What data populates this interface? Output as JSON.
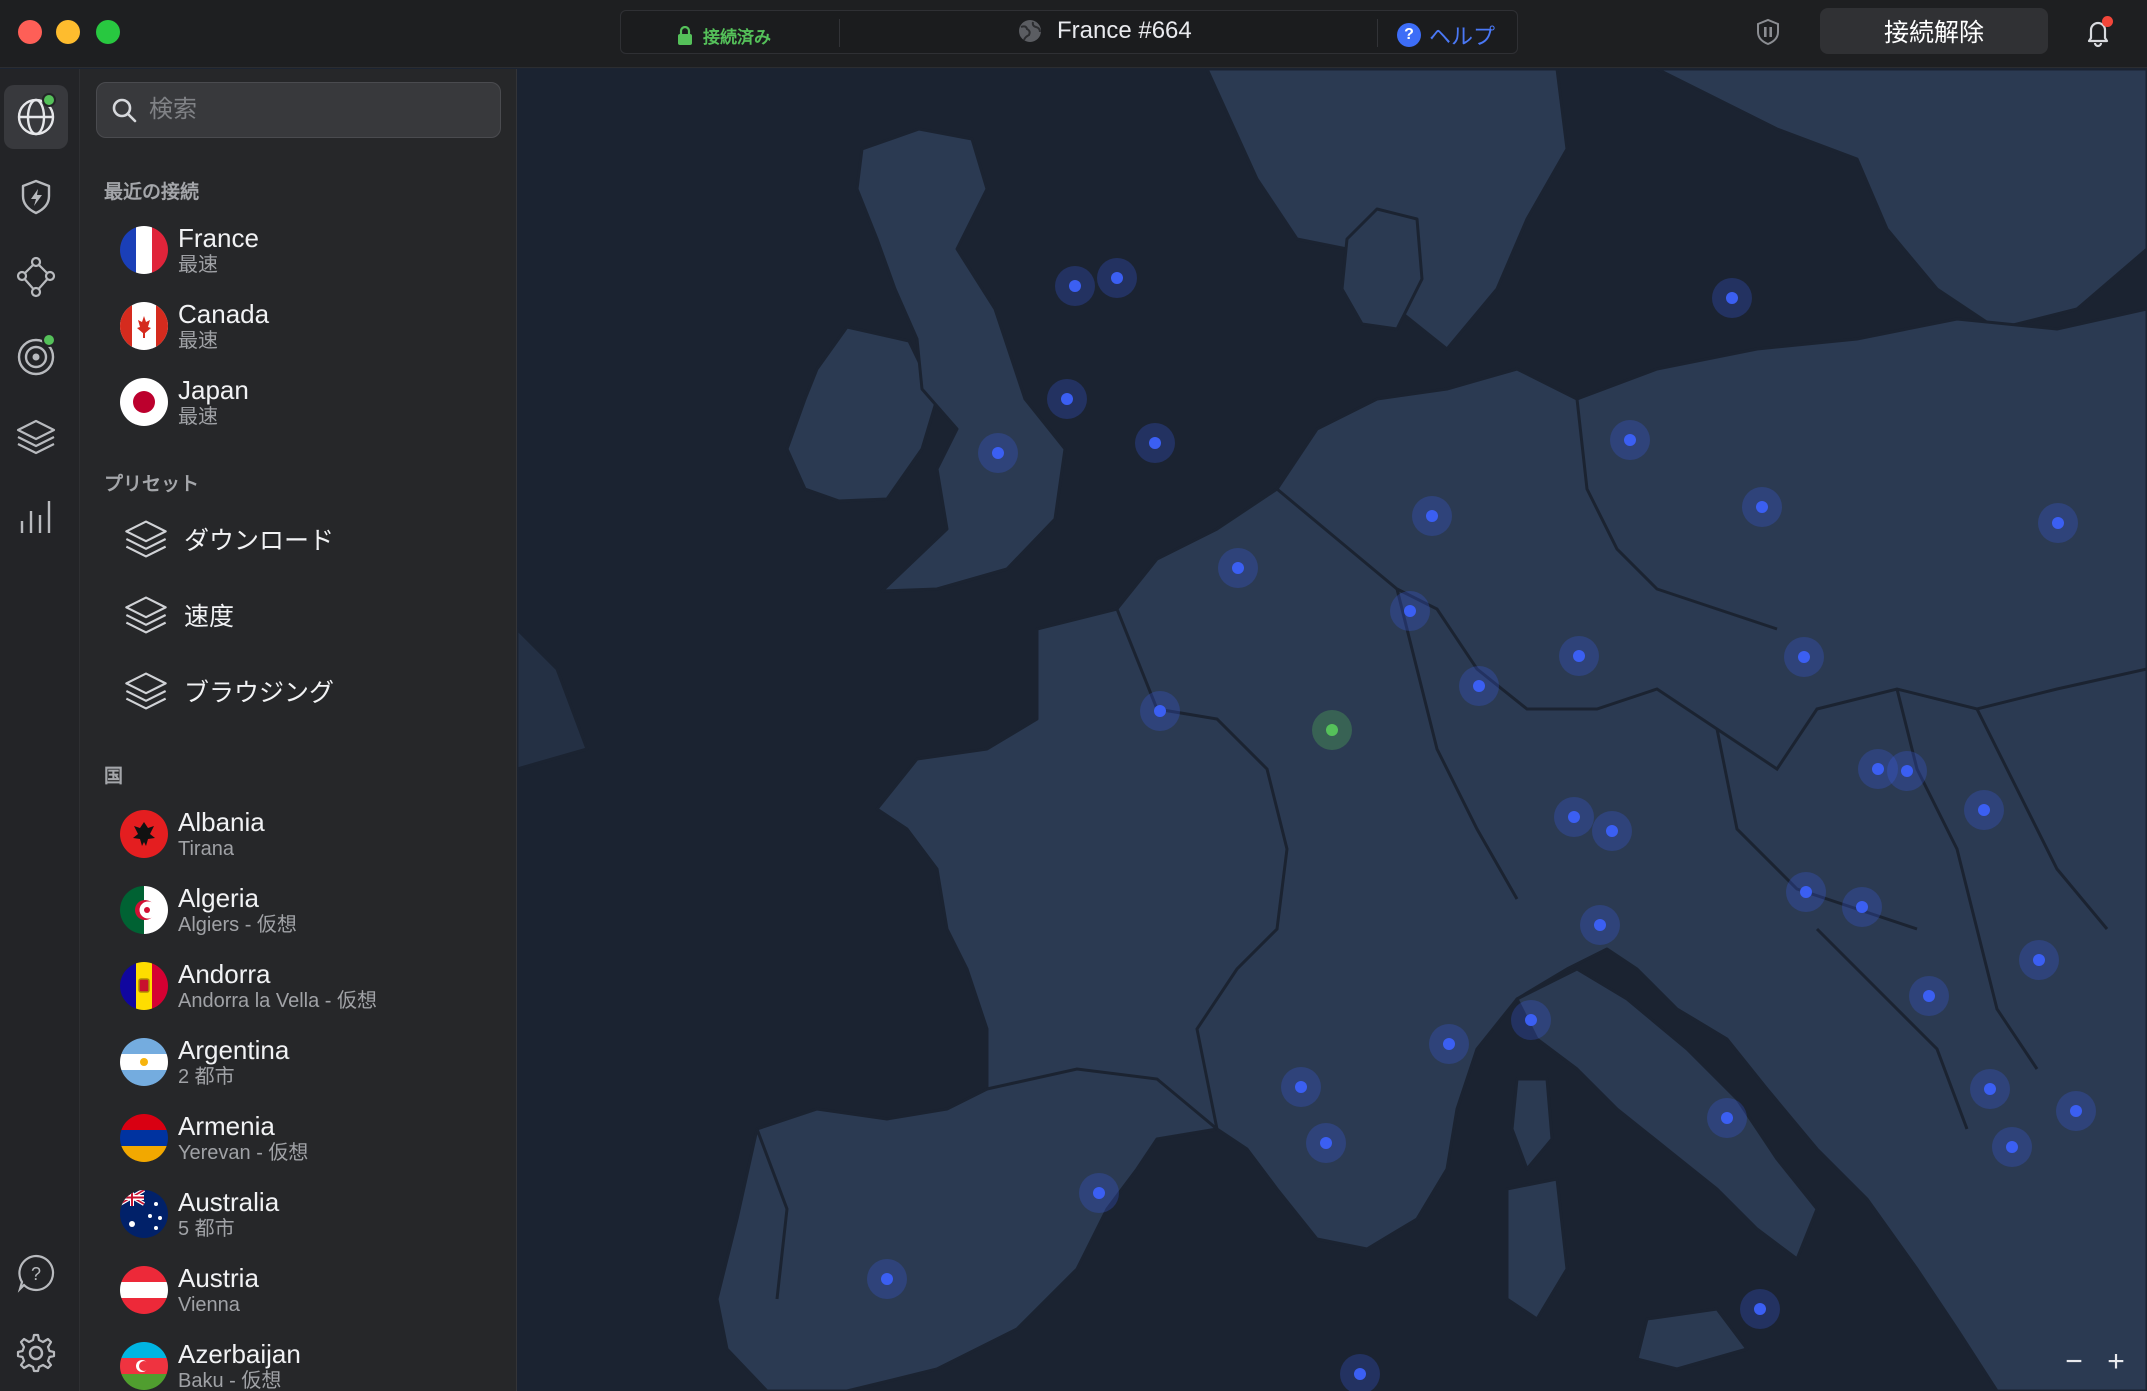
{
  "window": {
    "status": "接続済み",
    "server": "France #664",
    "help": "ヘルプ",
    "disconnect": "接続解除"
  },
  "search": {
    "placeholder": "検索"
  },
  "sections": {
    "recent": "最近の接続",
    "presets": "プリセット",
    "countries": "国"
  },
  "recent": [
    {
      "name": "France",
      "sub": "最速"
    },
    {
      "name": "Canada",
      "sub": "最速"
    },
    {
      "name": "Japan",
      "sub": "最速"
    }
  ],
  "presets": [
    {
      "label": "ダウンロード"
    },
    {
      "label": "速度"
    },
    {
      "label": "ブラウジング"
    }
  ],
  "countries": [
    {
      "name": "Albania",
      "sub": "Tirana"
    },
    {
      "name": "Algeria",
      "sub": "Algiers - 仮想"
    },
    {
      "name": "Andorra",
      "sub": "Andorra la Vella - 仮想"
    },
    {
      "name": "Argentina",
      "sub": "2 都市"
    },
    {
      "name": "Armenia",
      "sub": "Yerevan - 仮想"
    },
    {
      "name": "Australia",
      "sub": "5 都市"
    },
    {
      "name": "Austria",
      "sub": "Vienna"
    },
    {
      "name": "Azerbaijan",
      "sub": "Baku - 仮想"
    }
  ],
  "zoom": {
    "out": "−",
    "in": "+"
  },
  "colors": {
    "connected": "#55c15a",
    "accent": "#3d6df7",
    "map_sea": "#1b2331",
    "map_land": "#2b3a52",
    "server_pin": "#3b5ff2"
  },
  "icons": [
    "lock-icon",
    "globe-icon",
    "help-icon",
    "pause-icon",
    "bell-icon",
    "search-icon",
    "shield-icon",
    "meshnet-icon",
    "threat-icon",
    "layers-icon",
    "stats-icon",
    "settings-icon"
  ]
}
